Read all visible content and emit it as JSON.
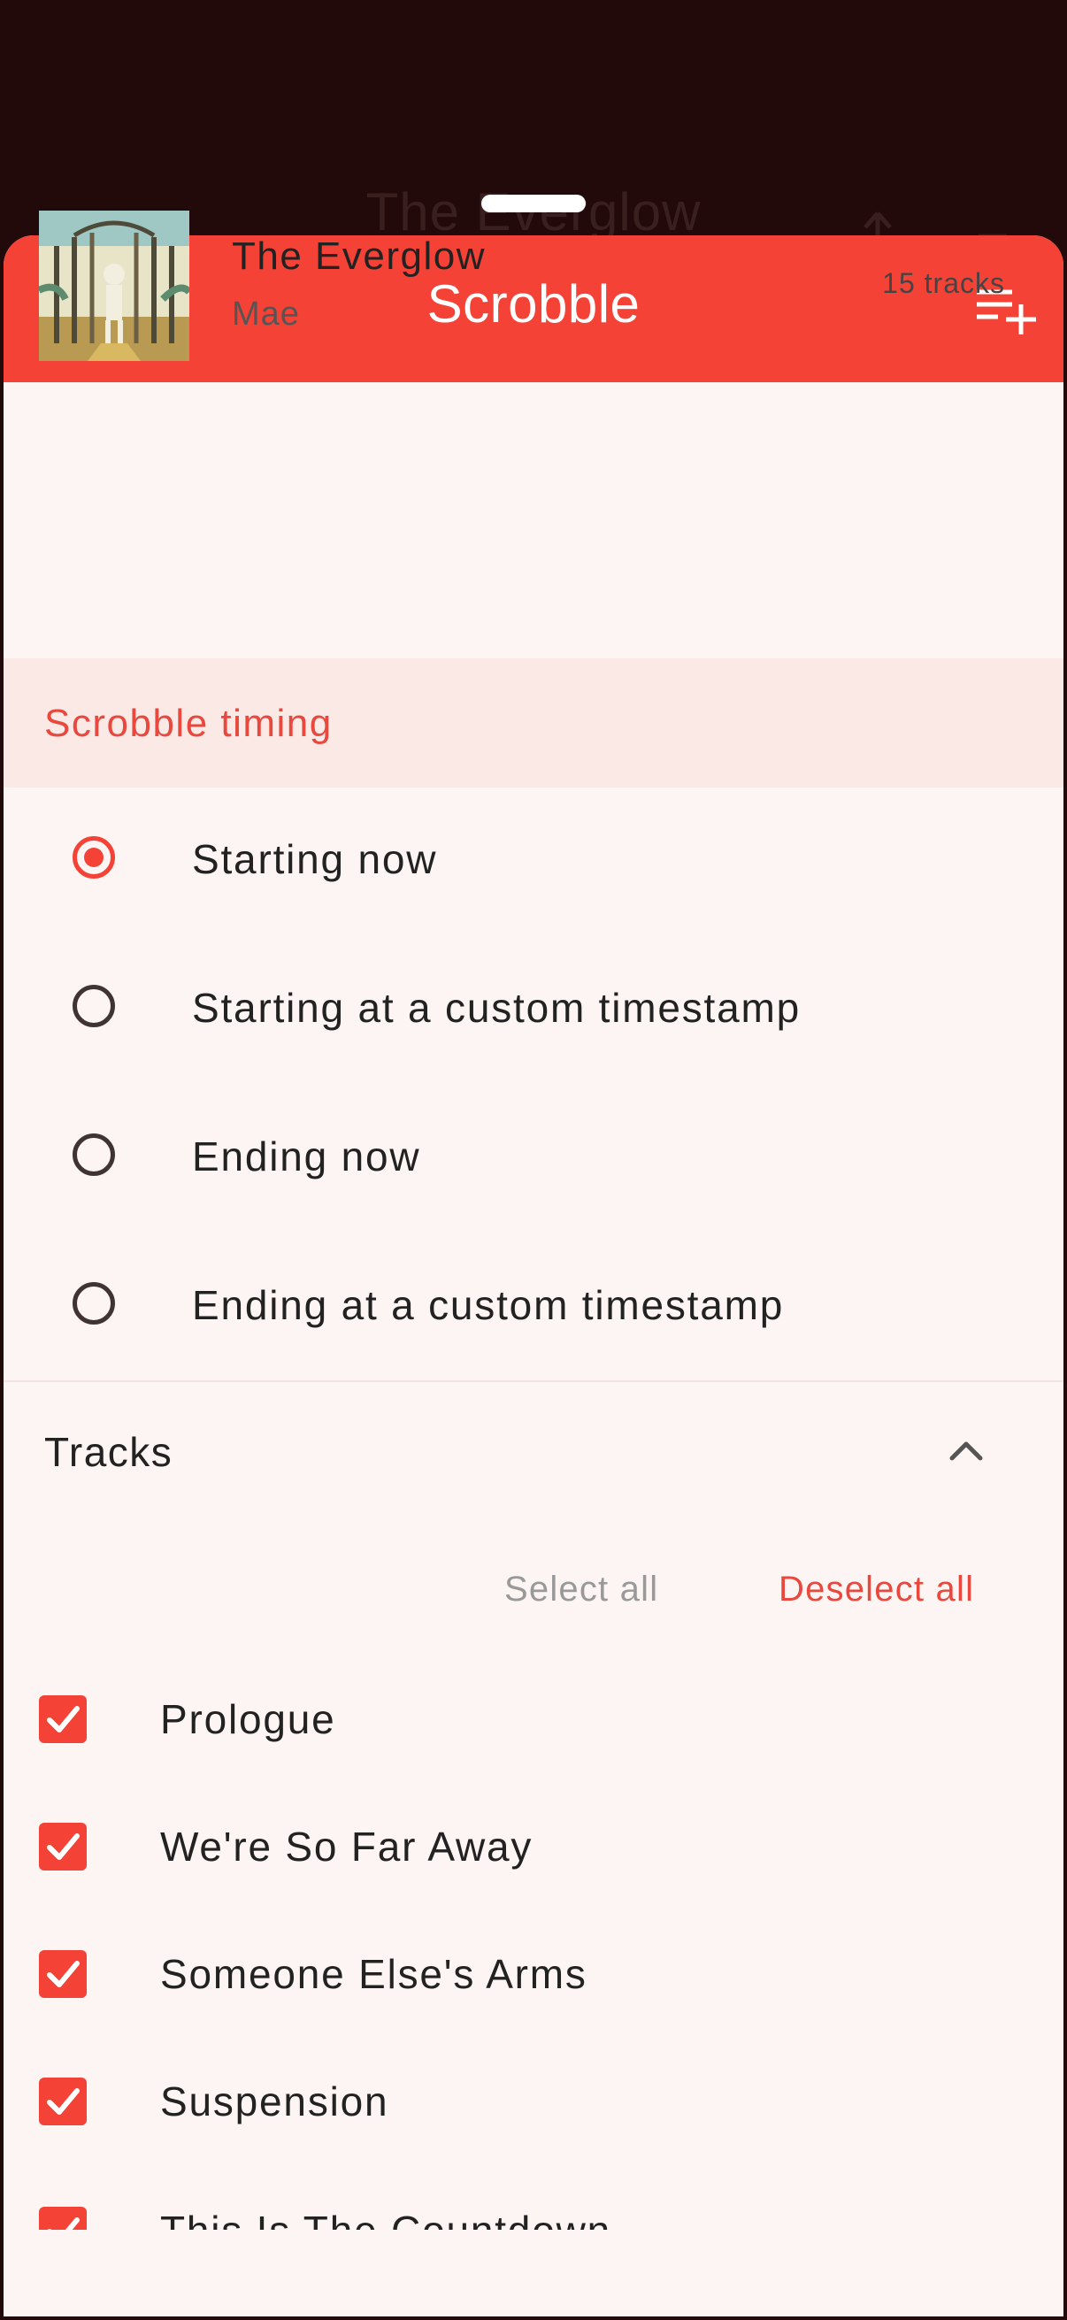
{
  "background": {
    "title": "The Everglow"
  },
  "colors": {
    "accent": "#f44336",
    "sheet_background": "#fdf5f3",
    "section_header_background": "#fbe9e6"
  },
  "topbar": {
    "title": "Scrobble",
    "back_icon": "chevron-left-icon",
    "action_icon": "playlist-add-icon"
  },
  "album": {
    "title": "The Everglow",
    "artist": "Mae",
    "track_count": "15 tracks"
  },
  "timing": {
    "header": "Scrobble timing",
    "selected_index": 0,
    "options": [
      {
        "label": "Starting now"
      },
      {
        "label": "Starting at a custom timestamp"
      },
      {
        "label": "Ending now"
      },
      {
        "label": "Ending at a custom timestamp"
      }
    ]
  },
  "tracks": {
    "header": "Tracks",
    "select_all": "Select all",
    "deselect_all": "Deselect all",
    "items": [
      {
        "title": "Prologue",
        "checked": true
      },
      {
        "title": "We're So Far Away",
        "checked": true
      },
      {
        "title": "Someone Else's Arms",
        "checked": true
      },
      {
        "title": "Suspension",
        "checked": true
      },
      {
        "title": "This Is The Countdown",
        "checked": true
      }
    ]
  }
}
